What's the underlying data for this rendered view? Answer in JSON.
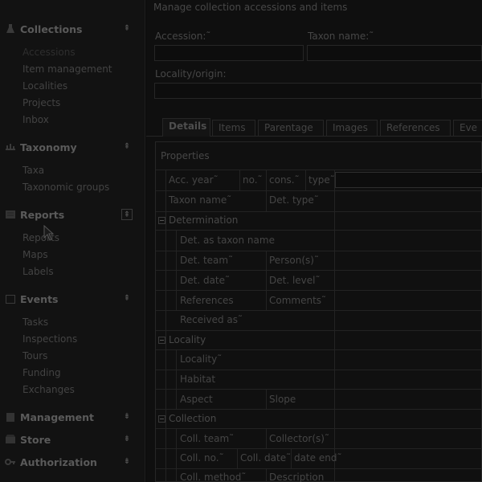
{
  "sidebar": {
    "sections": [
      {
        "title": "Collections",
        "icon": "flask-icon",
        "chevron": "⇞",
        "items": [
          "Accessions",
          "Item management",
          "Localities",
          "Projects",
          "Inbox"
        ],
        "selected": 0
      },
      {
        "title": "Taxonomy",
        "icon": "tree-icon",
        "chevron": "⇞",
        "items": [
          "Taxa",
          "Taxonomic groups"
        ]
      },
      {
        "title": "Reports",
        "icon": "report-icon",
        "chevron": "⇞",
        "items": [
          "Reports",
          "Maps",
          "Labels"
        ]
      },
      {
        "title": "Events",
        "icon": "calendar-icon",
        "chevron": "⇞",
        "items": [
          "Tasks",
          "Inspections",
          "Tours",
          "Funding",
          "Exchanges"
        ]
      },
      {
        "title": "Management",
        "icon": "building-icon",
        "chevron": "⇟",
        "items": []
      },
      {
        "title": "Store",
        "icon": "store-icon",
        "chevron": "⇟",
        "items": []
      },
      {
        "title": "Authorization",
        "icon": "key-icon",
        "chevron": "⇟",
        "items": []
      }
    ]
  },
  "main": {
    "header": "Manage collection accessions and items",
    "fields": {
      "accession_label": "Accession:",
      "taxon_label": "Taxon name:",
      "locality_label": "Locality/origin:",
      "required_mark": "˜"
    },
    "tabs": [
      "Details",
      "Items",
      "Parentage",
      "Images",
      "References",
      "Eve"
    ],
    "active_tab": 0,
    "properties": {
      "title": "Properties",
      "row_acc": {
        "acc_year": "Acc. year˜",
        "no": "no.˜",
        "cons": "cons.˜",
        "type": "type˜"
      },
      "row_taxon": {
        "taxon_name": "Taxon name˜",
        "det_type": "Det. type˜"
      },
      "determination": {
        "title": "Determination",
        "det_as_taxon": "Det. as taxon name",
        "det_team": "Det. team˜",
        "persons": "Person(s)˜",
        "det_date": "Det. date˜",
        "det_level": "Det. level˜",
        "references": "References",
        "comments": "Comments˜",
        "received_as": "Received as˜"
      },
      "locality": {
        "title": "Locality",
        "locality": "Locality˜",
        "habitat": "Habitat",
        "aspect": "Aspect",
        "slope": "Slope"
      },
      "collection": {
        "title": "Collection",
        "coll_team": "Coll. team˜",
        "collectors": "Collector(s)˜",
        "coll_no": "Coll. no.˜",
        "coll_date": "Coll. date˜",
        "date_end": "date end˜",
        "coll_method": "Coll. method˜",
        "description": "Description"
      }
    }
  }
}
